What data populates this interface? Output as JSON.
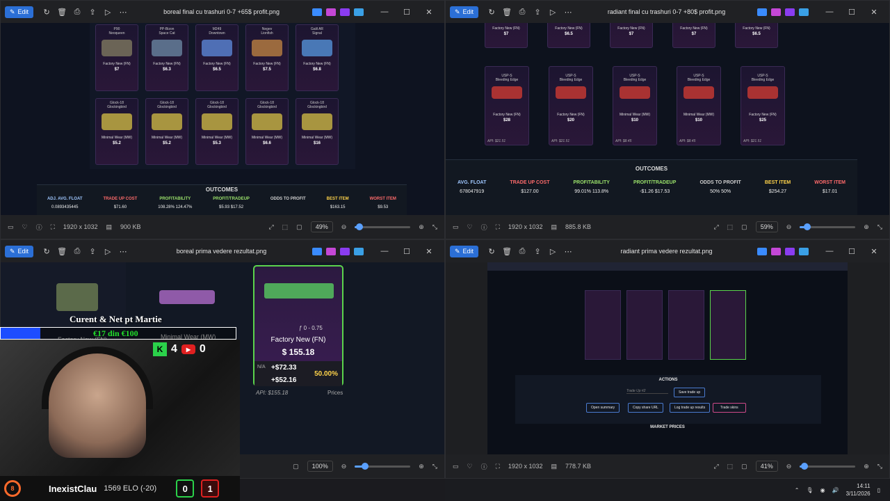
{
  "windows": {
    "tl": {
      "title": "boreal final cu trashuri 0-7 +65$ profit.png",
      "edit": "Edit",
      "dims": "1920 x 1032",
      "size": "900 KB",
      "zoom": "49%"
    },
    "tr": {
      "title": "radiant final cu trashuri 0-7 +80$ profit.png",
      "edit": "Edit",
      "dims": "1920 x 1032",
      "size": "885.8 KB",
      "zoom": "59%"
    },
    "bl": {
      "title": "boreal prima vedere rezultat.png",
      "edit": "Edit",
      "zoom": "100%"
    },
    "br": {
      "title": "radiant prima vedere rezultat.png",
      "edit": "Edit",
      "dims": "1920 x 1032",
      "size": "778.7 KB",
      "zoom": "41%"
    }
  },
  "tl_cards_row1": [
    {
      "name": "P90\nNeoqueen",
      "wear": "Factory New (FN)",
      "price": "$7"
    },
    {
      "name": "PP-Bizon\nSpace Cat",
      "wear": "Factory New (FN)",
      "price": "$6.3"
    },
    {
      "name": "M249\nDowntown",
      "wear": "Factory New (FN)",
      "price": "$6.5"
    },
    {
      "name": "Negev\nLionfish",
      "wear": "Factory New (FN)",
      "price": "$7.5"
    },
    {
      "name": "Galil AR\nSignal",
      "wear": "Factory New (FN)",
      "price": "$6.8"
    }
  ],
  "tl_cards_row2": [
    {
      "name": "Glock-18\nGlockingbird",
      "wear": "Minimal Wear (MW)",
      "price": "$5.2"
    },
    {
      "name": "Glock-18\nGlockingbird",
      "wear": "Minimal Wear (MW)",
      "price": "$5.2"
    },
    {
      "name": "Glock-18\nGlockingbird",
      "wear": "Minimal Wear (MW)",
      "price": "$5.3"
    },
    {
      "name": "Glock-18\nGlockingbird",
      "wear": "Minimal Wear (MW)",
      "price": "$6.6"
    },
    {
      "name": "Glock-18\nGlockingbird",
      "wear": "Minimal Wear (MW)",
      "price": "$16"
    }
  ],
  "tl_outcomes": {
    "title": "OUTCOMES",
    "cols": [
      {
        "h": "ADJ. AVG. FLOAT",
        "v": "0.0893435445",
        "c": "#9fc7ff"
      },
      {
        "h": "TRADE UP COST",
        "v": "$71.60",
        "c": "#ff6b6b"
      },
      {
        "h": "PROFITABILITY",
        "v": "108.28%   124.47%",
        "c": "#9be36b"
      },
      {
        "h": "PROFIT/TRADEUP",
        "v": "$5.93   $17.52",
        "c": "#9be36b"
      },
      {
        "h": "ODDS TO PROFIT",
        "v": "",
        "c": "#cfcfcf"
      },
      {
        "h": "BEST ITEM",
        "v": "$163.15",
        "c": "#ffd34a"
      },
      {
        "h": "WORST ITEM",
        "v": "$9.53",
        "c": "#ff6b6b"
      }
    ]
  },
  "tr_cards_top": [
    {
      "wear": "Factory New (FN)",
      "price": "$7"
    },
    {
      "wear": "Factory New (FN)",
      "price": "$6.5"
    },
    {
      "wear": "Factory New (FN)",
      "price": "$7"
    },
    {
      "wear": "Factory New (FN)",
      "price": "$7"
    },
    {
      "wear": "Factory New (FN)",
      "price": "$6.5"
    }
  ],
  "tr_cards_row2": [
    {
      "name": "USP-S\nBleeding Edge",
      "wear": "Factory New (FN)",
      "price": "$28",
      "api": "API: $21.51"
    },
    {
      "name": "USP-S\nBleeding Edge",
      "wear": "Factory New (FN)",
      "price": "$20",
      "api": "API: $21.51"
    },
    {
      "name": "USP-S\nBleeding Edge",
      "wear": "Minimal Wear (MW)",
      "price": "$10",
      "api": "API: $8.45"
    },
    {
      "name": "USP-S\nBleeding Edge",
      "wear": "Minimal Wear (MW)",
      "price": "$10",
      "api": "API: $8.45"
    },
    {
      "name": "USP-S\nBleeding Edge",
      "wear": "Factory New (FN)",
      "price": "$25",
      "api": "API: $21.51"
    }
  ],
  "tr_outcomes": {
    "title": "OUTCOMES",
    "cols": [
      {
        "h": "AVG. FLOAT",
        "v": "678047919",
        "c": "#9fc7ff"
      },
      {
        "h": "TRADE UP COST",
        "v": "$127.00",
        "c": "#ff6b6b"
      },
      {
        "h": "PROFITABILITY",
        "v": "99.01%   113.8%",
        "c": "#9be36b"
      },
      {
        "h": "PROFIT/TRADEUP",
        "v": "-$1.26   $17.53",
        "c": "#9be36b"
      },
      {
        "h": "ODDS TO PROFIT",
        "v": "50%   50%",
        "c": "#cfcfcf"
      },
      {
        "h": "BEST ITEM",
        "v": "$254.27",
        "c": "#ffd34a"
      },
      {
        "h": "WORST ITEM",
        "v": "$17.01",
        "c": "#ff6b6b"
      }
    ]
  },
  "bl_card": {
    "float": "ƒ 0 - 0.75",
    "wear": "Factory New (FN)",
    "price": "$ 155.18",
    "gain1": "+$72.33",
    "gain2": "+$52.16",
    "pct": "50.00%",
    "na": "N/A",
    "api": "API: $155.18",
    "prices": "Prices"
  },
  "bl_left_cards": {
    "left_wear": "Factory New (FN)",
    "right_wear": "Minimal Wear (MW)"
  },
  "br_page": {
    "actions_title": "ACTIONS",
    "tradeup_placeholder": "Trade Up #2",
    "save": "Save trade up",
    "open_summary": "Open summary",
    "copy_share": "Copy share URL",
    "log_results": "Log trade up results",
    "trade_skins": "Trade skins",
    "market_prices": "MARKET PRICES"
  },
  "stream": {
    "overlay_title": "Curent & Net pt Martie",
    "overlay_amount": "€17 din €100",
    "overlay_progress": 0.17,
    "kick_count": "4",
    "yt_count": "0",
    "player": "InexistClau",
    "elo": "1569 ELO (-20)",
    "level": "8",
    "score_win": "0",
    "score_loss": "1"
  },
  "taskbar": {
    "time": "14:11",
    "date": "3/11/2026"
  }
}
